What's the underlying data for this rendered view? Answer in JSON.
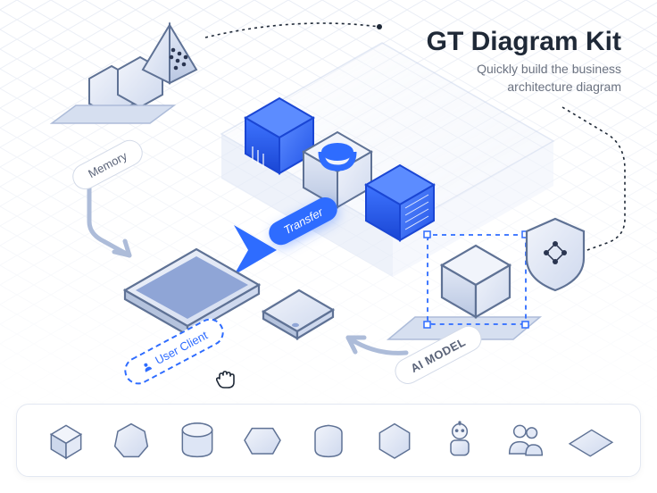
{
  "title": "GT Diagram Kit",
  "subtitle_line1": "Quickly build the business",
  "subtitle_line2": "architecture diagram",
  "labels": {
    "memory": "Memory",
    "transfer": "Transfer",
    "user_client": "User Client",
    "ai_model": "AI MODEL"
  },
  "colors": {
    "primary": "#2e6cff",
    "accent_line": "#adbcd9",
    "text_dark": "#1f2937",
    "text_muted": "#6b7280",
    "grid": "#e1e6f0",
    "shape_light": "#e9eef8",
    "shape_mid": "#cdd8ec",
    "shape_shadow": "#b5c3dd",
    "shape_stroke": "#5f7295"
  },
  "toolbar_items": [
    "cube-icon",
    "heptagon-icon",
    "cylinder-icon",
    "hexagon-icon",
    "rounded-cube-icon",
    "polygon-icon",
    "robot-icon",
    "people-icon",
    "tablet-icon"
  ],
  "canvas_nodes": [
    {
      "id": "hex-cluster",
      "type": "hex-pair"
    },
    {
      "id": "pyramid",
      "type": "pyramid-dots"
    },
    {
      "id": "storage1",
      "type": "server-cube-blue"
    },
    {
      "id": "storage2",
      "type": "database-cube-blue"
    },
    {
      "id": "storage3",
      "type": "rack-cube-blue"
    },
    {
      "id": "tablet",
      "type": "tablet-iso"
    },
    {
      "id": "phone",
      "type": "phone-iso"
    },
    {
      "id": "shield",
      "type": "shield-iso"
    },
    {
      "id": "ai-cube",
      "type": "cube-dashed-select"
    }
  ]
}
